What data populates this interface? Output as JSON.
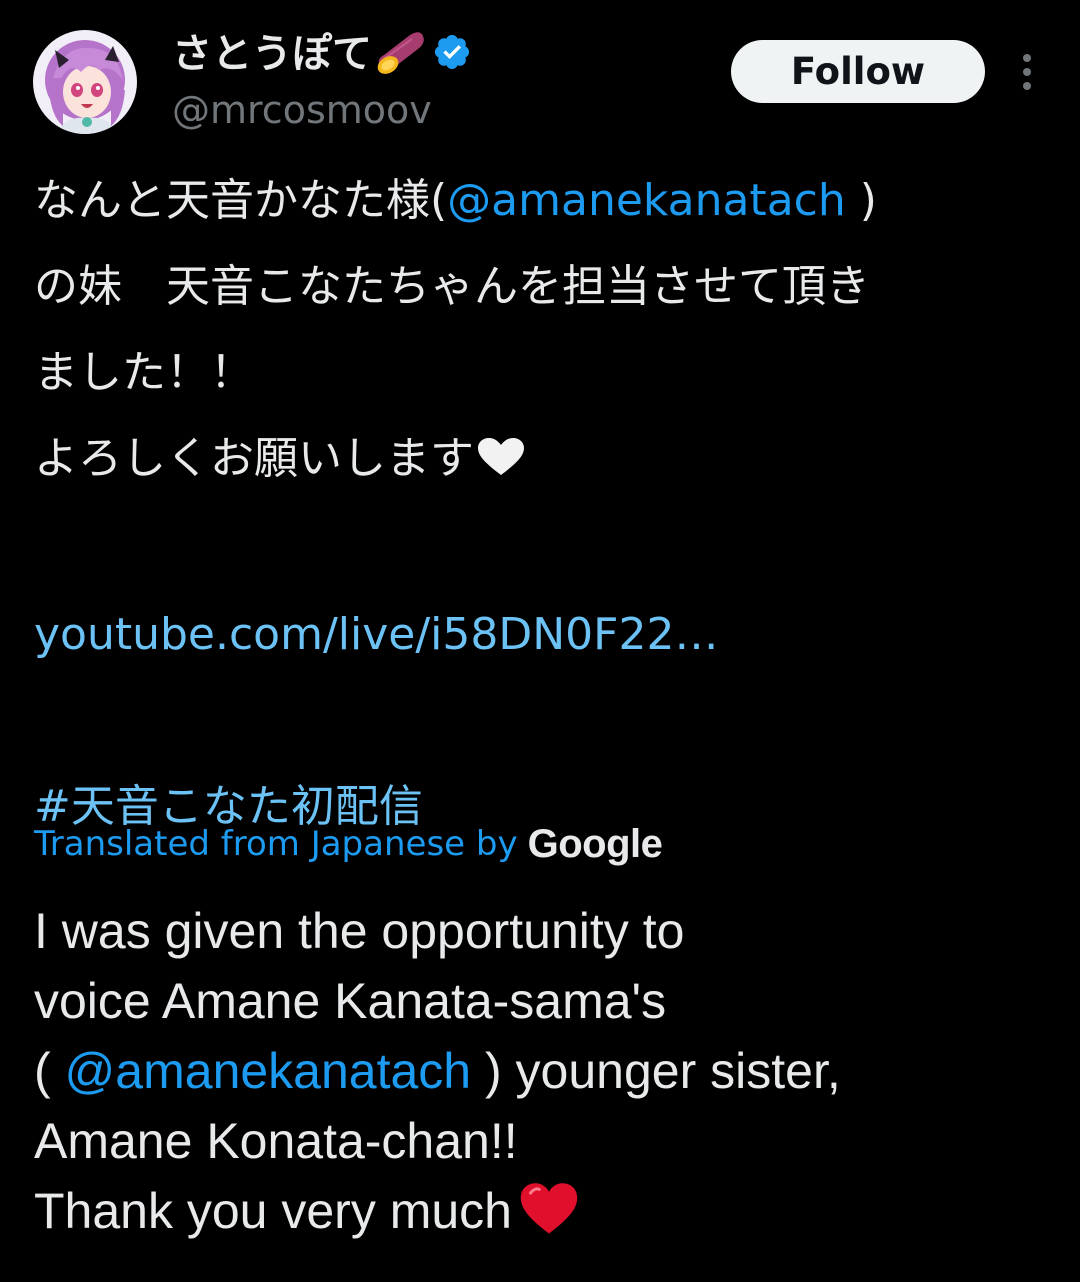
{
  "author": {
    "display_name": "さとうぽて",
    "handle": "@mrcosmoov",
    "name_emoji": "sweet-potato-icon",
    "verified_icon": "verified-badge-icon",
    "avatar_icon": "avatar-image"
  },
  "actions": {
    "follow_label": "Follow",
    "more_icon": "more-vertical-icon"
  },
  "tweet": {
    "line1_prefix": "なんと天音かなた様(",
    "line1_mention": "@amanekanatach",
    "line1_suffix": " )",
    "line2": "の妹　天音こなたちゃんを担当させて頂き",
    "line3": "ました！！",
    "line4": "よろしくお願いします",
    "line4_emoji": "white-heart-icon",
    "link": "youtube.com/live/i58DN0F22…",
    "hashtag": "#天音こなた初配信"
  },
  "translation": {
    "label": "Translated from Japanese by",
    "provider": "Google",
    "line1": "I was given the opportunity to",
    "line2": "voice Amane Kanata-sama's",
    "line3_prefix": "( ",
    "line3_mention": "@amanekanatach",
    "line3_suffix": " ) younger sister,",
    "line4": "Amane Konata-chan!!",
    "line5": "Thank you very much",
    "line5_emoji": "red-heart-icon"
  },
  "colors": {
    "background": "#000000",
    "text": "#e7e9ea",
    "secondary_text": "#71767b",
    "link": "#1d9bf0",
    "verified": "#1d9bf0",
    "follow_bg": "#eff3f4",
    "heart_red": "#e0102c"
  }
}
